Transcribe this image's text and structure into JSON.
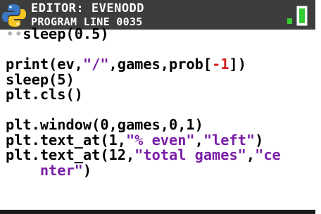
{
  "header": {
    "title": "EDITOR: EVENODD",
    "subtitle": "PROGRAM LINE 0035",
    "logo_icon": "python-logo-icon",
    "battery_icon": "battery-icon",
    "colors": {
      "header_bg": "#3d3d3d",
      "battery": "#33cc33"
    }
  },
  "editor": {
    "lines": [
      {
        "indent": "••",
        "parts": [
          {
            "t": "sleep(",
            "k": "code"
          },
          {
            "t": "0.5",
            "k": "code"
          },
          {
            "t": ")",
            "k": "code"
          }
        ]
      },
      {
        "indent": "",
        "parts": []
      },
      {
        "indent": "",
        "parts": [
          {
            "t": "print(ev,",
            "k": "code"
          },
          {
            "t": "\"/\"",
            "k": "str"
          },
          {
            "t": ",games,prob[",
            "k": "code"
          },
          {
            "t": "-1",
            "k": "num"
          },
          {
            "t": "])",
            "k": "code"
          }
        ]
      },
      {
        "indent": "",
        "parts": [
          {
            "t": "sleep(5)",
            "k": "code"
          }
        ]
      },
      {
        "indent": "",
        "parts": [
          {
            "t": "plt.cls()",
            "k": "code"
          }
        ]
      },
      {
        "indent": "",
        "parts": []
      },
      {
        "indent": "",
        "parts": [
          {
            "t": "plt.window(0,games,0,1)",
            "k": "code"
          }
        ]
      },
      {
        "indent": "",
        "parts": [
          {
            "t": "plt.text_at(1,",
            "k": "code"
          },
          {
            "t": "\"% even\"",
            "k": "str"
          },
          {
            "t": ",",
            "k": "code"
          },
          {
            "t": "\"left\"",
            "k": "str"
          },
          {
            "t": ")",
            "k": "code"
          }
        ]
      },
      {
        "indent": "",
        "parts": [
          {
            "t": "plt.text_at(12,",
            "k": "code"
          },
          {
            "t": "\"total games\"",
            "k": "str"
          },
          {
            "t": ",",
            "k": "code"
          },
          {
            "t": "\"ce",
            "k": "str"
          }
        ]
      },
      {
        "indent": "",
        "parts": [
          {
            "t": "    ",
            "k": "code"
          },
          {
            "t": "nter\"",
            "k": "str"
          },
          {
            "t": ")",
            "k": "code"
          }
        ]
      }
    ],
    "colors": {
      "text": "#000000",
      "string": "#7a1fa8",
      "number": "#d71e1e",
      "indent_marker": "#b3b3b3"
    }
  }
}
